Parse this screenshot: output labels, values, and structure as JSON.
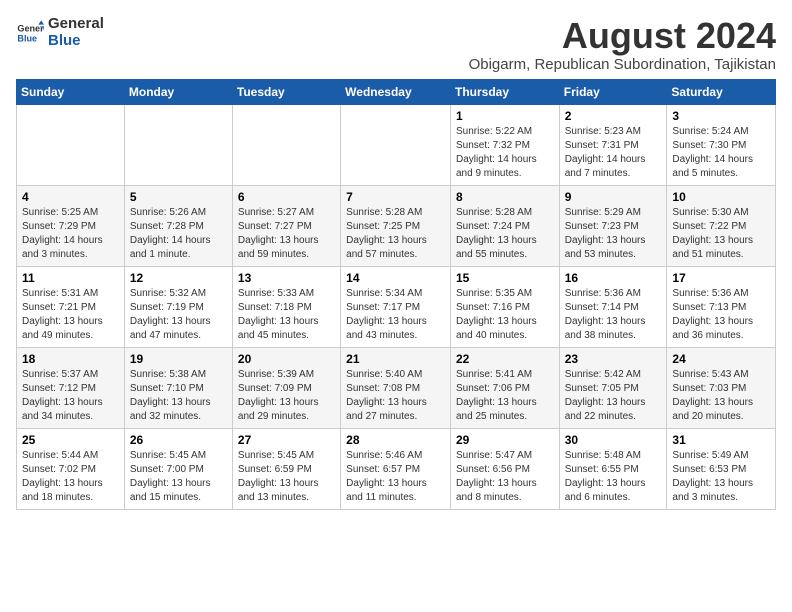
{
  "logo": {
    "line1": "General",
    "line2": "Blue"
  },
  "calendar": {
    "title": "August 2024",
    "subtitle": "Obigarm, Republican Subordination, Tajikistan"
  },
  "days_of_week": [
    "Sunday",
    "Monday",
    "Tuesday",
    "Wednesday",
    "Thursday",
    "Friday",
    "Saturday"
  ],
  "weeks": [
    [
      {
        "day": "",
        "info": ""
      },
      {
        "day": "",
        "info": ""
      },
      {
        "day": "",
        "info": ""
      },
      {
        "day": "",
        "info": ""
      },
      {
        "day": "1",
        "info": "Sunrise: 5:22 AM\nSunset: 7:32 PM\nDaylight: 14 hours\nand 9 minutes."
      },
      {
        "day": "2",
        "info": "Sunrise: 5:23 AM\nSunset: 7:31 PM\nDaylight: 14 hours\nand 7 minutes."
      },
      {
        "day": "3",
        "info": "Sunrise: 5:24 AM\nSunset: 7:30 PM\nDaylight: 14 hours\nand 5 minutes."
      }
    ],
    [
      {
        "day": "4",
        "info": "Sunrise: 5:25 AM\nSunset: 7:29 PM\nDaylight: 14 hours\nand 3 minutes."
      },
      {
        "day": "5",
        "info": "Sunrise: 5:26 AM\nSunset: 7:28 PM\nDaylight: 14 hours\nand 1 minute."
      },
      {
        "day": "6",
        "info": "Sunrise: 5:27 AM\nSunset: 7:27 PM\nDaylight: 13 hours\nand 59 minutes."
      },
      {
        "day": "7",
        "info": "Sunrise: 5:28 AM\nSunset: 7:25 PM\nDaylight: 13 hours\nand 57 minutes."
      },
      {
        "day": "8",
        "info": "Sunrise: 5:28 AM\nSunset: 7:24 PM\nDaylight: 13 hours\nand 55 minutes."
      },
      {
        "day": "9",
        "info": "Sunrise: 5:29 AM\nSunset: 7:23 PM\nDaylight: 13 hours\nand 53 minutes."
      },
      {
        "day": "10",
        "info": "Sunrise: 5:30 AM\nSunset: 7:22 PM\nDaylight: 13 hours\nand 51 minutes."
      }
    ],
    [
      {
        "day": "11",
        "info": "Sunrise: 5:31 AM\nSunset: 7:21 PM\nDaylight: 13 hours\nand 49 minutes."
      },
      {
        "day": "12",
        "info": "Sunrise: 5:32 AM\nSunset: 7:19 PM\nDaylight: 13 hours\nand 47 minutes."
      },
      {
        "day": "13",
        "info": "Sunrise: 5:33 AM\nSunset: 7:18 PM\nDaylight: 13 hours\nand 45 minutes."
      },
      {
        "day": "14",
        "info": "Sunrise: 5:34 AM\nSunset: 7:17 PM\nDaylight: 13 hours\nand 43 minutes."
      },
      {
        "day": "15",
        "info": "Sunrise: 5:35 AM\nSunset: 7:16 PM\nDaylight: 13 hours\nand 40 minutes."
      },
      {
        "day": "16",
        "info": "Sunrise: 5:36 AM\nSunset: 7:14 PM\nDaylight: 13 hours\nand 38 minutes."
      },
      {
        "day": "17",
        "info": "Sunrise: 5:36 AM\nSunset: 7:13 PM\nDaylight: 13 hours\nand 36 minutes."
      }
    ],
    [
      {
        "day": "18",
        "info": "Sunrise: 5:37 AM\nSunset: 7:12 PM\nDaylight: 13 hours\nand 34 minutes."
      },
      {
        "day": "19",
        "info": "Sunrise: 5:38 AM\nSunset: 7:10 PM\nDaylight: 13 hours\nand 32 minutes."
      },
      {
        "day": "20",
        "info": "Sunrise: 5:39 AM\nSunset: 7:09 PM\nDaylight: 13 hours\nand 29 minutes."
      },
      {
        "day": "21",
        "info": "Sunrise: 5:40 AM\nSunset: 7:08 PM\nDaylight: 13 hours\nand 27 minutes."
      },
      {
        "day": "22",
        "info": "Sunrise: 5:41 AM\nSunset: 7:06 PM\nDaylight: 13 hours\nand 25 minutes."
      },
      {
        "day": "23",
        "info": "Sunrise: 5:42 AM\nSunset: 7:05 PM\nDaylight: 13 hours\nand 22 minutes."
      },
      {
        "day": "24",
        "info": "Sunrise: 5:43 AM\nSunset: 7:03 PM\nDaylight: 13 hours\nand 20 minutes."
      }
    ],
    [
      {
        "day": "25",
        "info": "Sunrise: 5:44 AM\nSunset: 7:02 PM\nDaylight: 13 hours\nand 18 minutes."
      },
      {
        "day": "26",
        "info": "Sunrise: 5:45 AM\nSunset: 7:00 PM\nDaylight: 13 hours\nand 15 minutes."
      },
      {
        "day": "27",
        "info": "Sunrise: 5:45 AM\nSunset: 6:59 PM\nDaylight: 13 hours\nand 13 minutes."
      },
      {
        "day": "28",
        "info": "Sunrise: 5:46 AM\nSunset: 6:57 PM\nDaylight: 13 hours\nand 11 minutes."
      },
      {
        "day": "29",
        "info": "Sunrise: 5:47 AM\nSunset: 6:56 PM\nDaylight: 13 hours\nand 8 minutes."
      },
      {
        "day": "30",
        "info": "Sunrise: 5:48 AM\nSunset: 6:55 PM\nDaylight: 13 hours\nand 6 minutes."
      },
      {
        "day": "31",
        "info": "Sunrise: 5:49 AM\nSunset: 6:53 PM\nDaylight: 13 hours\nand 3 minutes."
      }
    ]
  ]
}
